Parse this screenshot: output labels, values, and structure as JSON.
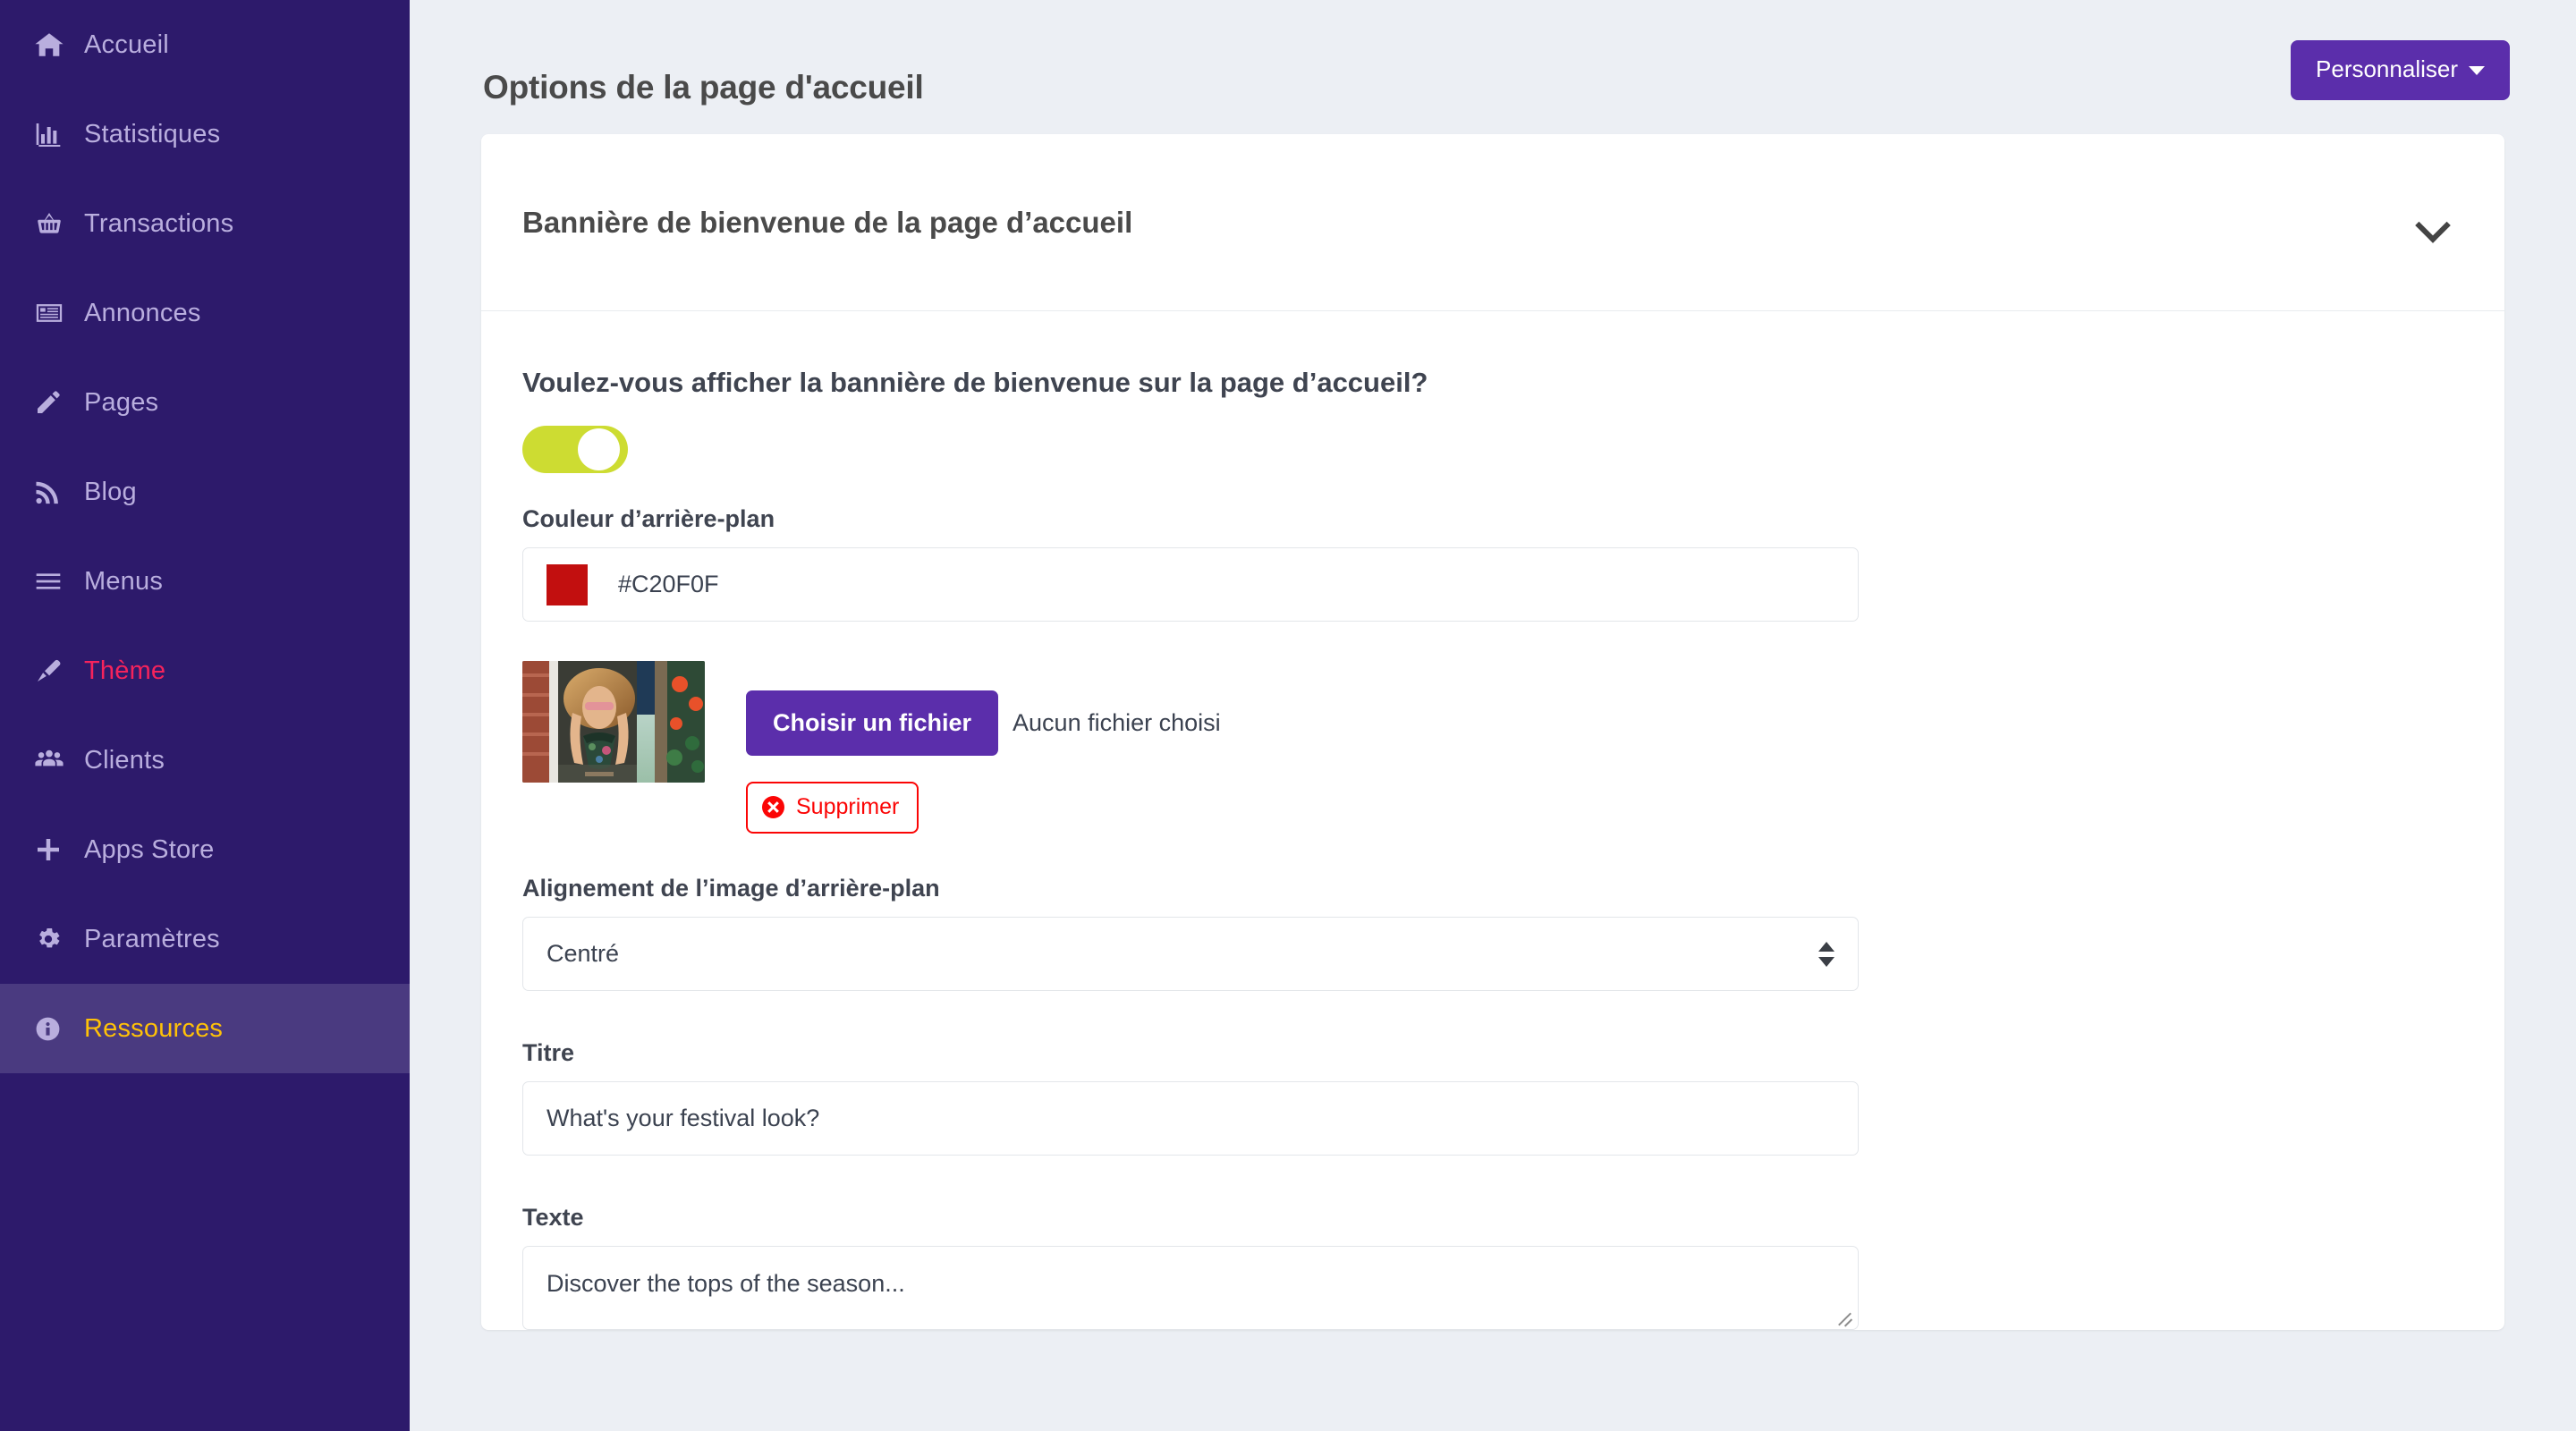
{
  "sidebar": {
    "items": [
      {
        "label": "Accueil",
        "icon": "home-icon",
        "state": "normal"
      },
      {
        "label": "Statistiques",
        "icon": "bar-chart-icon",
        "state": "normal"
      },
      {
        "label": "Transactions",
        "icon": "basket-icon",
        "state": "normal"
      },
      {
        "label": "Annonces",
        "icon": "list-card-icon",
        "state": "normal"
      },
      {
        "label": "Pages",
        "icon": "pencil-icon",
        "state": "normal"
      },
      {
        "label": "Blog",
        "icon": "rss-icon",
        "state": "normal"
      },
      {
        "label": "Menus",
        "icon": "hamburger-icon",
        "state": "normal"
      },
      {
        "label": "Thème",
        "icon": "paintbrush-icon",
        "state": "highlight"
      },
      {
        "label": "Clients",
        "icon": "users-icon",
        "state": "normal"
      },
      {
        "label": "Apps Store",
        "icon": "plus-icon",
        "state": "normal"
      },
      {
        "label": "Paramètres",
        "icon": "gear-icon",
        "state": "normal"
      },
      {
        "label": "Ressources",
        "icon": "info-icon",
        "state": "active"
      }
    ]
  },
  "header": {
    "title": "Options de la page d'accueil",
    "customize_button": "Personnaliser"
  },
  "card": {
    "title": "Bannière de bienvenue de la page d’accueil",
    "collapse_icon": "chevron-down-icon"
  },
  "form": {
    "show_banner_question": "Voulez-vous afficher la bannière de bienvenue sur la page d’accueil?",
    "show_banner_toggle": "on",
    "background_color_label": "Couleur d’arrière-plan",
    "background_color_value": "#C20F0F",
    "background_color_swatch": "#C20F0F",
    "choose_file_button": "Choisir un fichier",
    "no_file_chosen": "Aucun fichier choisi",
    "delete_button": "Supprimer",
    "image_alignment_label": "Alignement de l’image d’arrière-plan",
    "image_alignment_value": "Centré",
    "title_label": "Titre",
    "title_value": "What's your festival look?",
    "text_label": "Texte",
    "text_value": "Discover the tops of the season..."
  },
  "colors": {
    "sidebar_bg": "#2D1A6B",
    "sidebar_active_bg": "#4A3A80",
    "sidebar_text": "#B9AEDE",
    "theme_accent": "#F5235C",
    "active_accent": "#FFC107",
    "primary_button": "#5B2EAB",
    "toggle_on": "#CDDC32",
    "danger": "#FB0505",
    "page_bg": "#ECEFF4"
  }
}
